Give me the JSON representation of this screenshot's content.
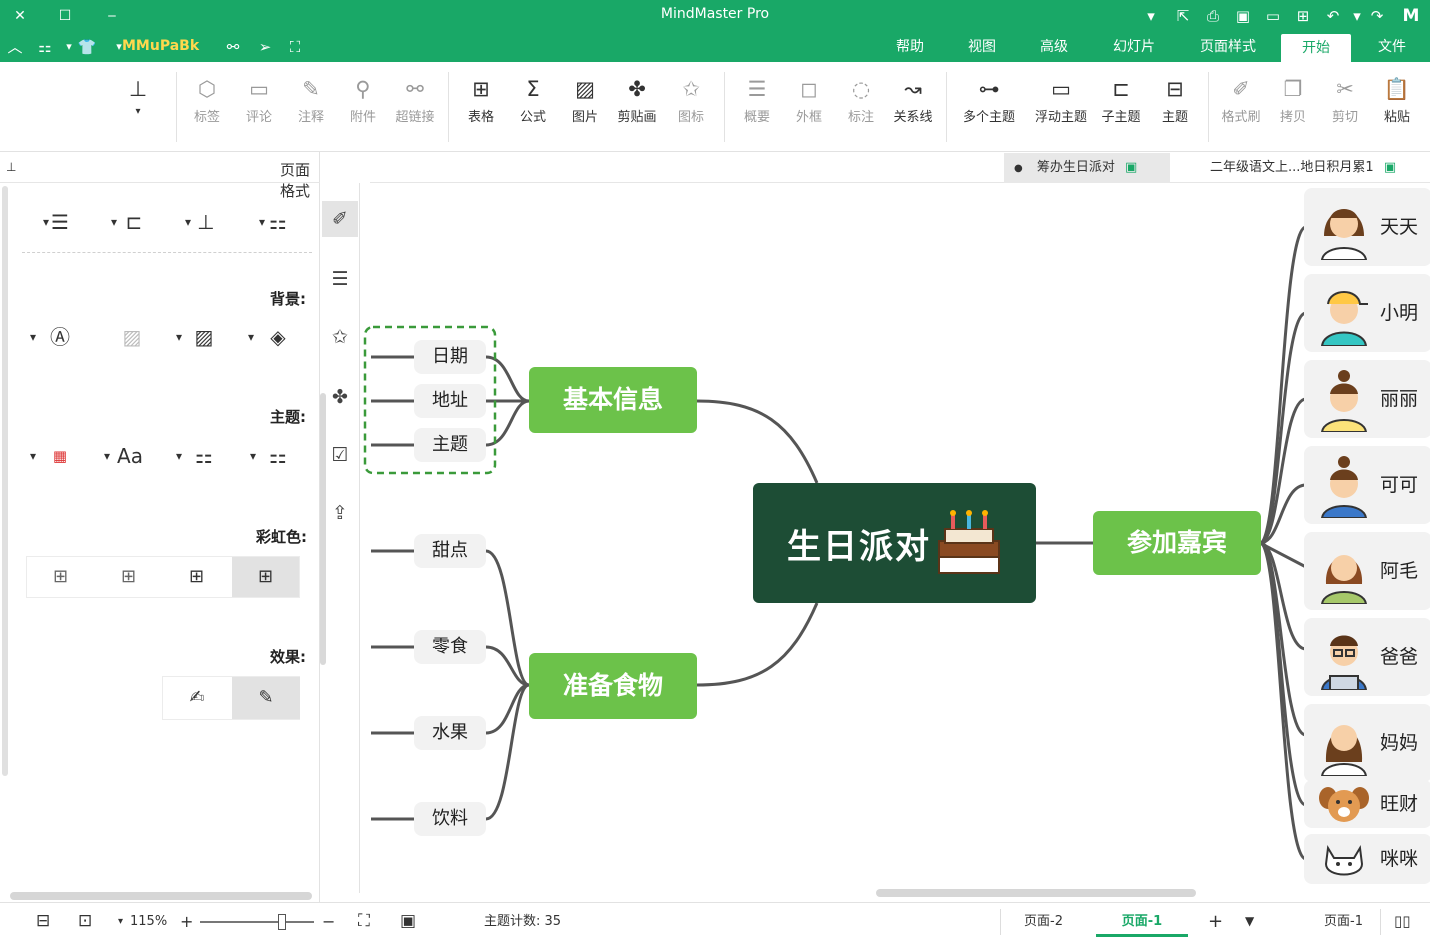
{
  "window": {
    "title": "MindMaster Pro",
    "brand": "MMuPaBk"
  },
  "menu": {
    "tabs": [
      "文件",
      "开始",
      "页面样式",
      "幻灯片",
      "高级",
      "视图",
      "帮助"
    ],
    "active": "开始"
  },
  "ribbon": {
    "buttons": [
      "粘贴",
      "剪切",
      "拷贝",
      "格式刷",
      "主题",
      "子主题",
      "浮动主题",
      "多个主题",
      "关系线",
      "标注",
      "外框",
      "概要",
      "图标",
      "剪贴画",
      "图片",
      "公式",
      "表格",
      "超链接",
      "附件",
      "注释",
      "评论",
      "标签"
    ]
  },
  "doc_tabs": [
    {
      "label": "二年级语文上...地日积月累1"
    },
    {
      "label": "筹办生日派对"
    }
  ],
  "panel": {
    "title": "页面格式",
    "sections": {
      "background": "背景:",
      "theme": "主题:",
      "rainbow": "彩虹色:",
      "effect": "效果:"
    },
    "theme_font": "Aa"
  },
  "mindmap": {
    "central": "生日派对",
    "branches": [
      {
        "label": "基本信息",
        "children": [
          "日期",
          "地址",
          "主题"
        ]
      },
      {
        "label": "准备食物",
        "children": [
          "甜点",
          "零食",
          "水果",
          "饮料"
        ]
      },
      {
        "label": "参加嘉宾",
        "children": [
          "天天",
          "小明",
          "丽丽",
          "可可",
          "阿毛",
          "爸爸",
          "妈妈",
          "旺财",
          "咪咪"
        ]
      }
    ]
  },
  "status": {
    "topic_count": "主题计数: 35",
    "zoom": "115%",
    "pages": [
      "页面-1",
      "页面-1",
      "页面-2"
    ]
  },
  "colors": {
    "brand_green": "#19a867",
    "central_fill": "#1d4d35",
    "branch_fill": "#6cc24a"
  }
}
